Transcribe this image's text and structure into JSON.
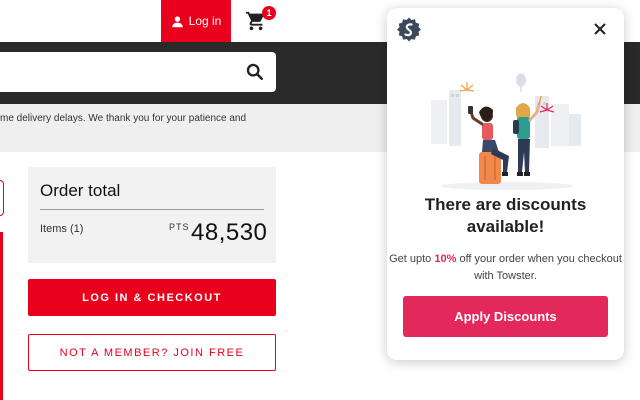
{
  "header": {
    "login_label": "Log in",
    "cart_count": "1"
  },
  "notice": {
    "text": "me delivery delays. We thank you for your patience and"
  },
  "order": {
    "title": "Order total",
    "items_label": "Items (1)",
    "pts_label": "PTS",
    "pts_value": "48,530"
  },
  "buttons": {
    "checkout_label": "LOG IN & CHECKOUT",
    "join_label": "NOT A MEMBER? JOIN FREE"
  },
  "popup": {
    "title_line1": "There are discounts",
    "title_line2": "available!",
    "body_prefix": "Get upto ",
    "body_highlight": "10%",
    "body_suffix": " off your order when you checkout with Towster.",
    "apply_label": "Apply Discounts",
    "accent_color": "#e3285b"
  },
  "colors": {
    "brand_red": "#e8001c",
    "dark_band": "#2a2a2a"
  }
}
